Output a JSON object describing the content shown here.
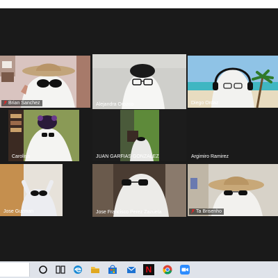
{
  "participants": [
    {
      "name": "Brian Sanchez",
      "muted": true
    },
    {
      "name": "Alejandra Orozco",
      "muted": false,
      "active": true
    },
    {
      "name": "Diego Ordaz",
      "muted": false
    },
    {
      "name": "Carolina",
      "muted": false
    },
    {
      "name": "JUAN GARFIAS GONZALEZ",
      "muted": false
    },
    {
      "name": "Argimiro Ramirez",
      "muted": false
    },
    {
      "name": "Jose Guzman",
      "muted": false
    },
    {
      "name": "Jose Francisco Perez Zazueta",
      "muted": false
    },
    {
      "name": "Ta Brisenho",
      "muted": true
    }
  ],
  "taskbar": {
    "icons": [
      "search-box",
      "cortana-icon",
      "task-view-icon",
      "edge-icon",
      "file-explorer-icon",
      "store-icon",
      "mail-icon",
      "netflix-icon",
      "chrome-icon",
      "zoom-icon"
    ],
    "netflix_letter": "N"
  },
  "colors": {
    "meeting_bg": "#1a1a1a",
    "active_speaker": "#d8e33a",
    "muted_red": "#e02828",
    "taskbar_bg": "#dfe3ea"
  }
}
